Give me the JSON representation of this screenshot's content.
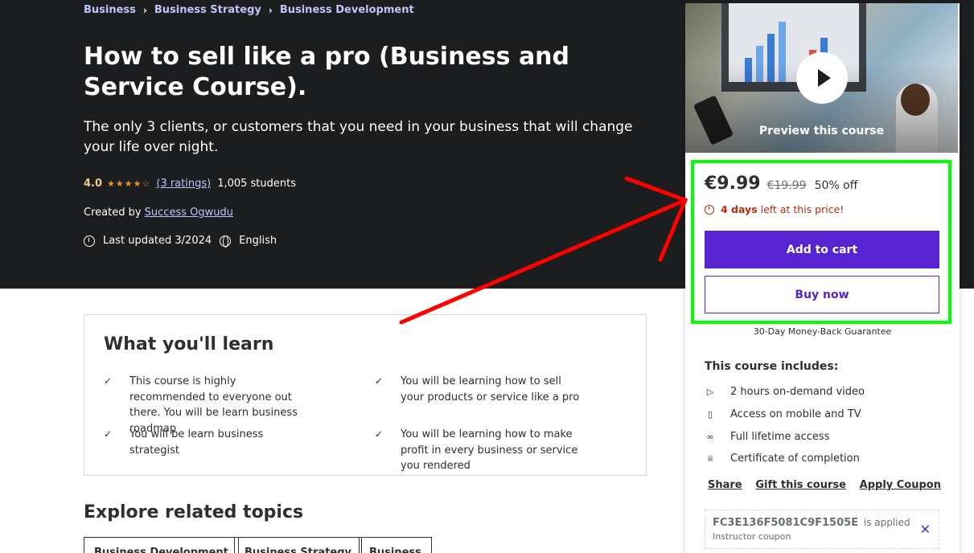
{
  "breadcrumb": [
    "Business",
    "Business Strategy",
    "Business Development"
  ],
  "course": {
    "title": "How to sell like a pro (Business and Service Course).",
    "subtitle": "The only 3 clients, or customers that you need in your business that will change your life over night.",
    "rating": "4.0",
    "stars": "★★★★☆",
    "ratings_link": "(3 ratings)",
    "students": "1,005 students",
    "created_by_label": "Created by",
    "instructor": "Success Ogwudu",
    "last_updated": "Last updated 3/2024",
    "language": "English"
  },
  "learn": {
    "title": "What you'll learn",
    "check_glyph": "✓",
    "items": [
      "This course is highly recommended to everyone out there. You will be learn business roadmap",
      "You will be learning how to sell your products or service like a pro",
      "You will be learn business strategist",
      "You will be learning how to make profit in every business or service you rendered"
    ]
  },
  "explore": {
    "title": "Explore related topics",
    "topics": [
      "Business Development",
      "Business Strategy",
      "Business"
    ]
  },
  "sidebar": {
    "preview_label": "Preview this course",
    "price": "€9.99",
    "original_price": "€19.99",
    "discount": "50% off",
    "timer_days": "4 days",
    "timer_rest": "left at this price!",
    "add_to_cart": "Add to cart",
    "buy_now": "Buy now",
    "guarantee": "30-Day Money-Back Guarantee",
    "includes_title": "This course includes:",
    "includes": [
      {
        "icon": "video-icon",
        "glyph": "▷",
        "text": "2 hours on-demand video"
      },
      {
        "icon": "mobile-icon",
        "glyph": "▯",
        "text": "Access on mobile and TV"
      },
      {
        "icon": "infinity-icon",
        "glyph": "∞",
        "text": "Full lifetime access"
      },
      {
        "icon": "trophy-icon",
        "glyph": "♕",
        "text": "Certificate of completion"
      }
    ],
    "links": {
      "share": "Share",
      "gift": "Gift this course",
      "coupon": "Apply Coupon"
    },
    "coupon_code": "FC3E136F5081C9F1505E",
    "coupon_applied": "is applied",
    "coupon_type": "Instructor coupon",
    "close_glyph": "✕"
  },
  "colors": {
    "hero_bg": "#1c1d1f",
    "accent_purple": "#5624d0",
    "link_purple": "#c0c4fc",
    "star_orange": "#e59819",
    "timer_red": "#b32d0f",
    "annotation_green": "#00ff00",
    "annotation_red": "#ff0000"
  }
}
